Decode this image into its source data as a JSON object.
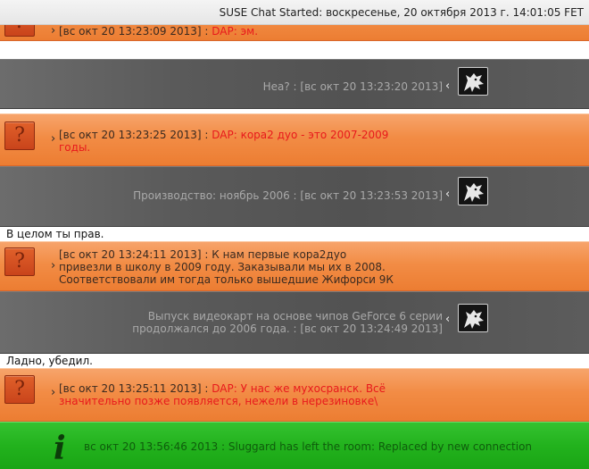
{
  "header": {
    "title": "SUSE Chat Started: воскресенье, 20 октября 2013 г. 14:01:05 FET"
  },
  "messages": [
    {
      "time": "[вс окт 20 13:23:09 2013] : ",
      "sender": "DAP: ",
      "text": "эм."
    },
    {
      "time": "[вс окт 20 13:23:20 2013]",
      "text": "Неа? : "
    },
    {
      "time": "[вс окт 20 13:23:25 2013] : ",
      "sender": "DAP: ",
      "text_line1": "кора2 дуо - это 2007-2009",
      "text_line2": "годы."
    },
    {
      "time": "[вс окт 20 13:23:53 2013]",
      "text": "Производство: ноябрь 2006 : "
    },
    {
      "plain": "В целом ты прав."
    },
    {
      "line1": "[вс окт 20 13:24:11 2013] : К нам первые кора2дуо",
      "line2": "привезли в школу в 2009 году. Заказывали мы их в 2008.",
      "line3": "Соответствовали им тогда только вышедшие Жифорси 9К"
    },
    {
      "line1": "Выпуск видеокарт на основе чипов GeForce 6 серии",
      "line2": "продолжался до 2006 года. : [вс окт 20 13:24:49 2013]"
    },
    {
      "plain": "Ладно, убедил."
    },
    {
      "time": "[вс окт 20 13:25:11 2013] : ",
      "sender": "DAP: ",
      "text_line1": "У нас же мухосранск. Всё",
      "text_line2": "значительно позже появляется, нежели в нерезиновке\\"
    },
    {
      "text": "вс окт 20 13:56:46 2013 : Sluggard has left the room: Replaced by new connection"
    }
  ],
  "icons": {
    "question": "question-avatar-icon",
    "wolf": "wolf-avatar-icon",
    "info": "i"
  },
  "colors": {
    "orange": "#f28c45",
    "gray": "#5a5a5a",
    "green": "#22b21d",
    "red_text": "#e8191c"
  }
}
